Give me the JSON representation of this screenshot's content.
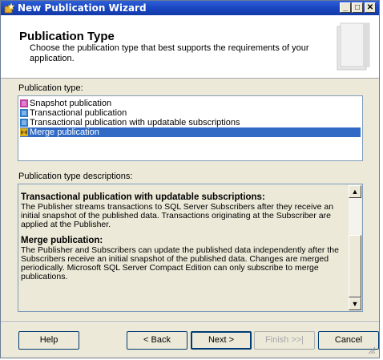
{
  "window": {
    "title": "New Publication Wizard"
  },
  "header": {
    "title": "Publication Type",
    "description": "Choose the publication type that best supports the requirements of your application."
  },
  "publication_type": {
    "label": "Publication type:",
    "items": [
      {
        "label": "Snapshot publication",
        "icon": "snapshot-icon",
        "selected": false
      },
      {
        "label": "Transactional publication",
        "icon": "transactional-icon",
        "selected": false
      },
      {
        "label": "Transactional publication with updatable subscriptions",
        "icon": "transactional-updatable-icon",
        "selected": false
      },
      {
        "label": "Merge publication",
        "icon": "merge-icon",
        "selected": true
      }
    ]
  },
  "descriptions": {
    "label": "Publication type descriptions:",
    "sections": [
      {
        "heading": "Transactional publication with updatable subscriptions:",
        "body": "The Publisher streams transactions to SQL Server Subscribers after they receive an initial snapshot of the published data. Transactions originating at the Subscriber are applied at the Publisher."
      },
      {
        "heading": "Merge publication:",
        "body": "The Publisher and Subscribers can update the published data independently after the Subscribers receive an initial snapshot of the published data. Changes are merged periodically. Microsoft SQL Server Compact Edition can only subscribe to merge publications."
      }
    ]
  },
  "buttons": {
    "help": "Help",
    "back": "< Back",
    "next": "Next >",
    "finish": "Finish >>|",
    "cancel": "Cancel"
  },
  "colors": {
    "selection": "#316ac5",
    "titlebar": "#1a47c0",
    "dialog": "#ece9d8"
  }
}
